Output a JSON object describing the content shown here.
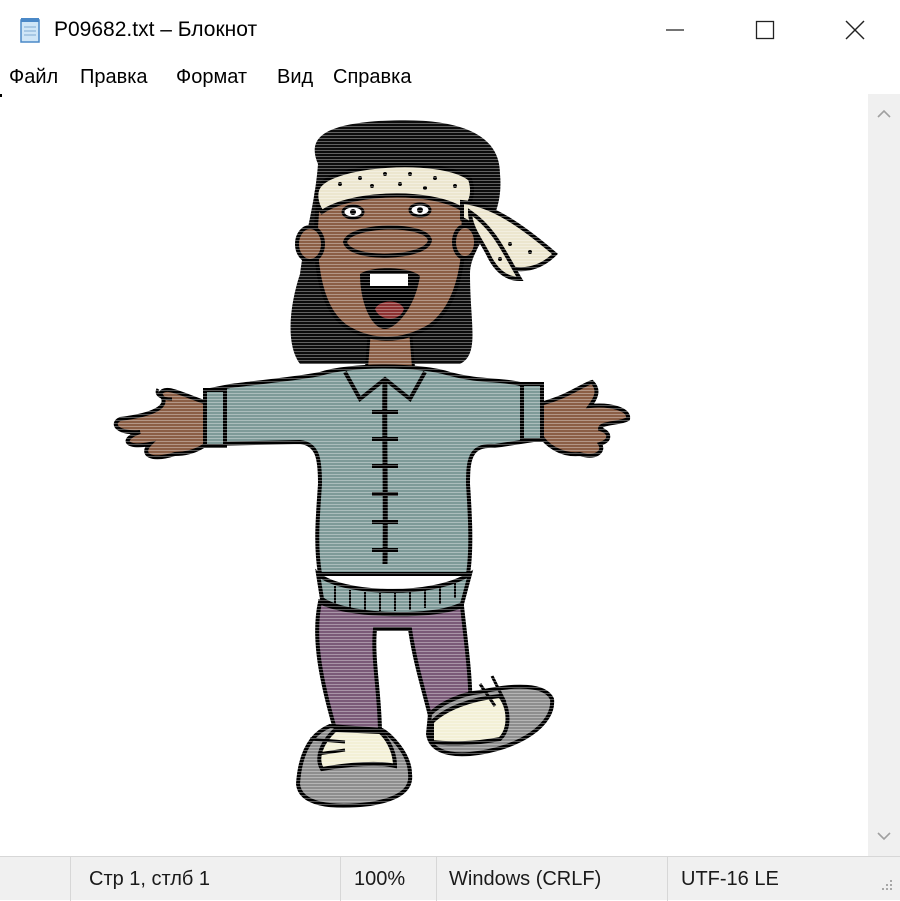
{
  "window": {
    "title": "P09682.txt – Блокнот",
    "controls": {
      "minimize": "minimize",
      "maximize": "maximize",
      "close": "close"
    }
  },
  "menu": {
    "items": [
      "Файл",
      "Правка",
      "Формат",
      "Вид",
      "Справка"
    ]
  },
  "editor": {
    "content": "ASCII-art cartoon character: smiling man with bandana, shaggy black hair, blue-gray shirt, purple pants, sneakers, arms outstretched"
  },
  "statusbar": {
    "position": "Стр 1, стлб 1",
    "zoom": "100%",
    "line_ending": "Windows (CRLF)",
    "encoding": "UTF-16 LE"
  },
  "colors": {
    "skin": "#8b5e45",
    "shirt": "#7e9a98",
    "pants": "#7a5a78",
    "hair": "#0c0c0c",
    "bandana": "#ece6cf",
    "sneaker": "#f3f0d6",
    "shoe_gray": "#8e8e8e",
    "statusbar_bg": "#f0f0f0"
  }
}
